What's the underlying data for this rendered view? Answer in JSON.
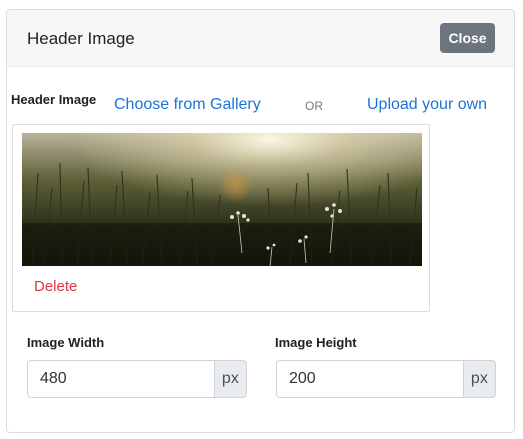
{
  "panel": {
    "title": "Header Image",
    "close_label": "Close"
  },
  "image_section": {
    "label": "Header Image",
    "gallery_link": "Choose from Gallery",
    "or_text": "OR",
    "upload_link": "Upload your own",
    "delete_label": "Delete",
    "preview": "header-image-preview"
  },
  "dimensions": {
    "width_label": "Image Width",
    "width_value": "480",
    "width_unit": "px",
    "height_label": "Image Height",
    "height_value": "200",
    "height_unit": "px"
  },
  "colors": {
    "link": "#1a73d9",
    "delete": "#dc3545",
    "close_button": "#6c757d"
  }
}
